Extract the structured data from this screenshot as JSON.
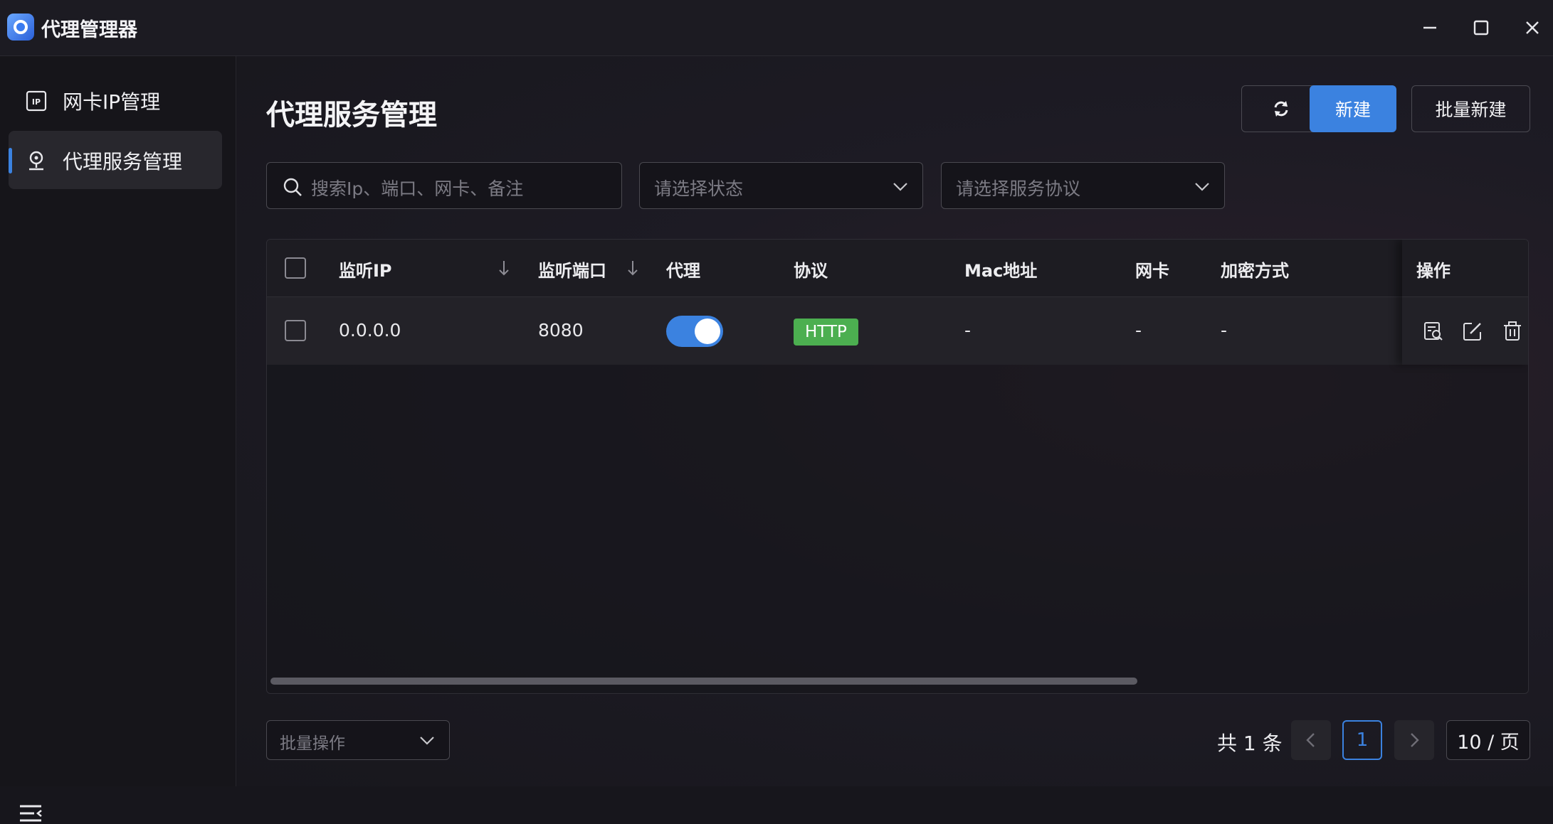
{
  "app": {
    "title": "代理管理器"
  },
  "sidebar": {
    "items": [
      {
        "label": "网卡IP管理",
        "icon": "ip-icon",
        "active": false
      },
      {
        "label": "代理服务管理",
        "icon": "proxy-service-icon",
        "active": true
      }
    ]
  },
  "page": {
    "title": "代理服务管理"
  },
  "toolbar": {
    "refresh_icon": "refresh-icon",
    "new_label": "新建",
    "batch_new_label": "批量新建"
  },
  "filters": {
    "search_placeholder": "搜索Ip、端口、网卡、备注",
    "status_placeholder": "请选择状态",
    "protocol_placeholder": "请选择服务协议"
  },
  "table": {
    "columns": [
      "监听IP",
      "监听端口",
      "代理",
      "协议",
      "Mac地址",
      "网卡",
      "加密方式",
      "操作"
    ],
    "rows": [
      {
        "ip": "0.0.0.0",
        "port": "8080",
        "proxy_enabled": true,
        "protocol": "HTTP",
        "mac": "-",
        "nic": "-",
        "encryption": "-"
      }
    ]
  },
  "footer": {
    "batch_placeholder": "批量操作",
    "total": "共 1 条",
    "current_page": "1",
    "page_size": "10 / 页"
  },
  "colors": {
    "accent": "#3b82e0",
    "tag_green": "#4caf50"
  }
}
